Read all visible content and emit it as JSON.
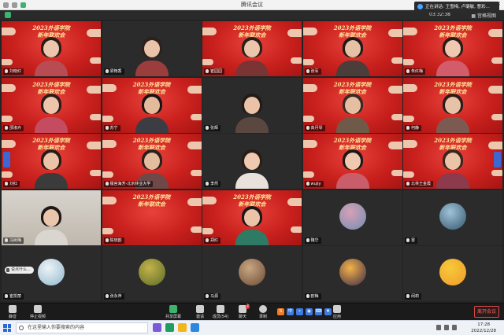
{
  "window": {
    "title": "腾讯会议",
    "minimize": "—",
    "maximize": "□",
    "close": "✕"
  },
  "banner": {
    "text": "正在讲话: 王雪梅, 卢璐敏, 曹彩..."
  },
  "status": {
    "duration": "03:32:38",
    "view_label": "▦ 宫格视图"
  },
  "event_title_line1": "2023外语学院",
  "event_title_line2": "新年联欢会",
  "tiles": [
    {
      "name": "刘晓红",
      "kind": "red",
      "row": 0,
      "col": 0,
      "skin": "#ecc7ad",
      "hair": "#2a1d19",
      "shirt": "#b94b52"
    },
    {
      "name": "梁艳香",
      "kind": "dark",
      "row": 0,
      "col": 1,
      "skin": "#e9c3aa",
      "hair": "#2d211c",
      "shirt": "#9b3d3d"
    },
    {
      "name": "崔园园",
      "kind": "red",
      "row": 0,
      "col": 2,
      "skin": "#ebc6ab",
      "hair": "#2b1f1a",
      "shirt": "#7a3434"
    },
    {
      "name": "张军",
      "kind": "red",
      "row": 0,
      "col": 3,
      "skin": "#e7c1a4",
      "hair": "#1f1a18",
      "shirt": "#4a3d3a"
    },
    {
      "name": "朱红梅",
      "kind": "red",
      "row": 0,
      "col": 4,
      "skin": "#f0c8b0",
      "hair": "#2a1d19",
      "shirt": "#d25c6a"
    },
    {
      "name": "邵淑卉",
      "kind": "red",
      "row": 1,
      "col": 0,
      "skin": "#ecc5aa",
      "hair": "#2a1d19",
      "shirt": "#c44b60"
    },
    {
      "name": "苏宁",
      "kind": "red",
      "row": 1,
      "col": 1,
      "skin": "#e3bb9c",
      "hair": "#1a1514",
      "shirt": "#3c3c44"
    },
    {
      "name": "张辉",
      "kind": "dark",
      "row": 1,
      "col": 2,
      "skin": "#eac3a8",
      "hair": "#241a17",
      "shirt": "#5a4840"
    },
    {
      "name": "高月琴",
      "kind": "red",
      "row": 1,
      "col": 3,
      "skin": "#e6bfa3",
      "hair": "#3a2a22",
      "shirt": "#6f5a4a"
    },
    {
      "name": "何静",
      "kind": "red",
      "row": 1,
      "col": 4,
      "skin": "#e8c2a6",
      "hair": "#2a1d19",
      "shirt": "#7c5a52"
    },
    {
      "name": "刘红",
      "kind": "red",
      "row": 2,
      "col": 0,
      "skin": "#ebc4a8",
      "hair": "#251c18",
      "shirt": "#3b3b3b"
    },
    {
      "name": "檀宫海芳-北京林业大学",
      "kind": "red",
      "row": 2,
      "col": 1,
      "skin": "#e4bc9f",
      "hair": "#2a1f1b",
      "shirt": "#704848"
    },
    {
      "name": "李然",
      "kind": "dark",
      "row": 2,
      "col": 2,
      "skin": "#efcab0",
      "hair": "#2a1d19",
      "shirt": "#e8e2da"
    },
    {
      "name": "wujiy",
      "kind": "red",
      "row": 2,
      "col": 3,
      "skin": "#efcab0",
      "hair": "#1f1817",
      "shirt": "#c95d6a"
    },
    {
      "name": "北林王金霞",
      "kind": "red",
      "row": 2,
      "col": 4,
      "skin": "#ebc3a6",
      "hair": "#3a2620",
      "shirt": "#8c3a4c"
    },
    {
      "name": "冯树梅",
      "kind": "photo",
      "row": 3,
      "col": 0,
      "skin": "#eac6ad",
      "hair": "#1f1817",
      "shirt": "#d9d5cf"
    },
    {
      "name": "陈晓韵",
      "kind": "red",
      "row": 3,
      "col": 1
    },
    {
      "name": "郑红",
      "kind": "red",
      "row": 3,
      "col": 2,
      "skin": "#ebc4a8",
      "hair": "#1f1817",
      "shirt": "#2f7a64"
    },
    {
      "name": "魏华",
      "kind": "avatar",
      "row": 3,
      "col": 3,
      "av1": "#d8a0b8",
      "av2": "#6f8fb0"
    },
    {
      "name": "雯",
      "kind": "avatar",
      "row": 3,
      "col": 4,
      "av1": "#9fc3d8",
      "av2": "#34566e"
    },
    {
      "name": "崔凯丽",
      "kind": "avatar",
      "row": 4,
      "col": 0,
      "av1": "#eef3f6",
      "av2": "#8fb9cf",
      "say": "说点什么..."
    },
    {
      "name": "张永萍",
      "kind": "avatar",
      "row": 4,
      "col": 1,
      "av1": "#c3b34a",
      "av2": "#5c6a2a"
    },
    {
      "name": "马源",
      "kind": "avatar",
      "row": 4,
      "col": 2,
      "av1": "#c9a783",
      "av2": "#6b4a34"
    },
    {
      "name": "欧梅",
      "kind": "avatar",
      "row": 4,
      "col": 3,
      "av1": "#f4b248",
      "av2": "#3a2a48"
    },
    {
      "name": "闵莉",
      "kind": "avatar",
      "row": 4,
      "col": 4,
      "av1": "#f7c93a",
      "av2": "#f19a2a"
    }
  ],
  "toolbar": {
    "mute": "静音",
    "video": "停止视频",
    "share": "共享屏幕",
    "invite": "邀请",
    "members": "成员(54)",
    "chat": "聊天",
    "chat_badge": "2",
    "record": "录制",
    "apps": "应用",
    "leave": "离开会议"
  },
  "taskbar": {
    "search_placeholder": "在这里输入你要搜索的内容",
    "time": "17:28",
    "date": "2022/12/28"
  }
}
